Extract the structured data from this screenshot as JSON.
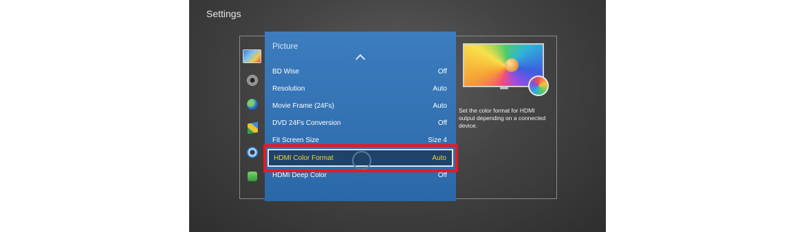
{
  "header": {
    "title": "Settings"
  },
  "sidebar": {
    "icons": [
      "picture-icon",
      "sound-icon",
      "network-icon",
      "smart-hub-icon",
      "system-icon",
      "support-icon"
    ]
  },
  "menu": {
    "title": "Picture",
    "items": [
      {
        "label": "BD Wise",
        "value": "Off"
      },
      {
        "label": "Resolution",
        "value": "Auto"
      },
      {
        "label": "Movie Frame (24Fs)",
        "value": "Auto"
      },
      {
        "label": "DVD 24Fs Conversion",
        "value": "Off"
      },
      {
        "label": "Fit Screen Size",
        "value": "Size 4"
      },
      {
        "label": "HDMI Color Format",
        "value": "Auto"
      },
      {
        "label": "HDMI Deep Color",
        "value": "Off"
      }
    ],
    "selected_index": 5
  },
  "preview": {
    "description": "Set the color format for HDMI output depending on a connected device."
  },
  "colors": {
    "panel": "#2f6fb0",
    "selected_text": "#f3d43d",
    "highlight_border": "#e41b23"
  }
}
